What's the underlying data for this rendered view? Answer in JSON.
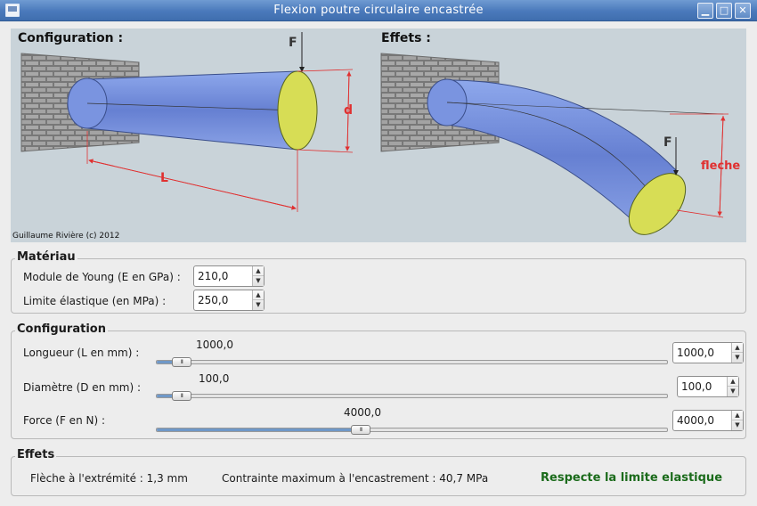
{
  "window": {
    "title": "Flexion poutre circulaire encastrée"
  },
  "illustration": {
    "config_label": "Configuration :",
    "effects_label": "Effets :",
    "force_label": "F",
    "diameter_label": "d",
    "length_label": "L",
    "force_label_2": "F",
    "deflection_label": "fleche",
    "copyright": "Guillaume Rivière (c) 2012",
    "colors": {
      "beam": "#6f8fdb",
      "tip": "#dbe25a",
      "dim": "#e03030",
      "wall": "#8f8f8f"
    }
  },
  "materiau": {
    "title": "Matériau",
    "young_label": "Module de Young (E en GPa) :",
    "young_value": "210,0",
    "limit_label": "Limite élastique (en MPa) :",
    "limit_value": "250,0"
  },
  "configuration": {
    "title": "Configuration",
    "length": {
      "label": "Longueur (L en mm) :",
      "display": "1000,0",
      "value": "1000,0",
      "fraction": 0.05
    },
    "diameter": {
      "label": "Diamètre (D en mm) :",
      "display": "100,0",
      "value": "100,0",
      "fraction": 0.05
    },
    "force": {
      "label": "Force (F en N) :",
      "display": "4000,0",
      "value": "4000,0",
      "fraction": 0.4
    }
  },
  "effets": {
    "title": "Effets",
    "deflection": "Flèche à l'extrémité : 1,3 mm",
    "stress": "Contrainte maximum à l'encastrement : 40,7 MPa",
    "status": "Respecte la limite elastique"
  }
}
